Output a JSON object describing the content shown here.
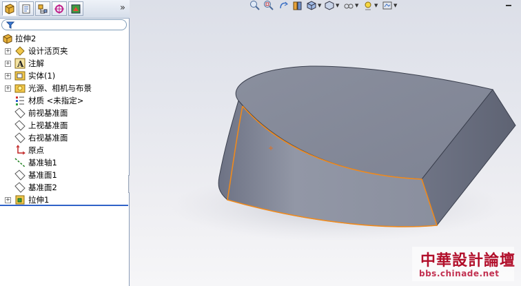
{
  "panel": {
    "tabs": [
      {
        "icon": "feature-manager-icon"
      },
      {
        "icon": "property-manager-icon"
      },
      {
        "icon": "configuration-manager-icon"
      },
      {
        "icon": "dimxpert-icon"
      },
      {
        "icon": "display-manager-icon"
      }
    ],
    "more_glyph": "»",
    "filter_icon": "filter-icon",
    "tree": {
      "root": "拉伸2",
      "items": [
        {
          "label": "设计活页夹",
          "icon": "design-binder-icon",
          "expandable": true
        },
        {
          "label": "注解",
          "icon": "annotations-icon",
          "expandable": true
        },
        {
          "label": "实体(1)",
          "icon": "solid-bodies-icon",
          "expandable": true
        },
        {
          "label": "光源、相机与布景",
          "icon": "lights-cameras-icon",
          "expandable": true
        },
        {
          "label": "材质 <未指定>",
          "icon": "material-icon",
          "expandable": false
        },
        {
          "label": "前视基准面",
          "icon": "plane-icon",
          "expandable": false
        },
        {
          "label": "上视基准面",
          "icon": "plane-icon",
          "expandable": false
        },
        {
          "label": "右视基准面",
          "icon": "plane-icon",
          "expandable": false
        },
        {
          "label": "原点",
          "icon": "origin-icon",
          "expandable": false
        },
        {
          "label": "基准轴1",
          "icon": "axis-icon",
          "expandable": false
        },
        {
          "label": "基准面1",
          "icon": "plane-icon",
          "expandable": false
        },
        {
          "label": "基准面2",
          "icon": "plane-icon",
          "expandable": false
        },
        {
          "label": "拉伸1",
          "icon": "extrude-icon",
          "expandable": true
        }
      ]
    }
  },
  "view_toolbar": {
    "icons": [
      "zoom-to-fit-icon",
      "zoom-area-icon",
      "previous-view-icon",
      "section-view-icon",
      "view-orientation-icon",
      "display-style-icon",
      "hide-show-icon",
      "edit-appearance-icon",
      "apply-scene-icon",
      "view-settings-icon"
    ]
  },
  "watermark": {
    "title": "中華設計論壇",
    "url": "bbs.chinade.net"
  },
  "colors": {
    "accent": "#2f62c8",
    "model_face": "#8a8f9e",
    "selected_edge": "#f08a1c",
    "watermark": "#b10e2a"
  }
}
